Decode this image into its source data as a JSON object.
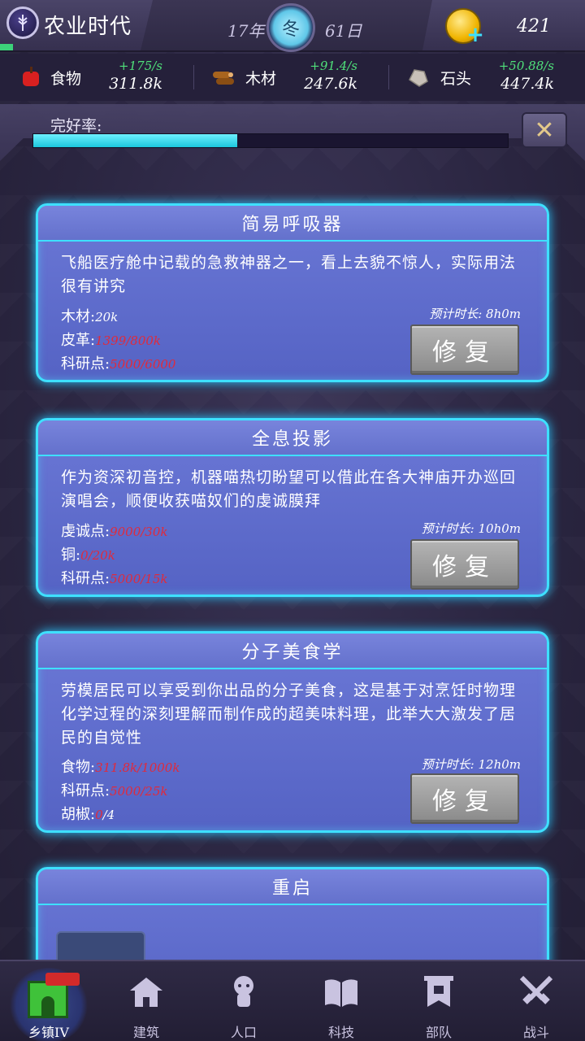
{
  "header": {
    "era_title": "农业时代",
    "year": "17年",
    "season": "冬",
    "day": "61日",
    "coins": "421"
  },
  "resources": [
    {
      "name": "食物",
      "rate": "+175/s",
      "amount": "311.8k",
      "icon": "apple-icon"
    },
    {
      "name": "木材",
      "rate": "+91.4/s",
      "amount": "247.6k",
      "icon": "log-icon"
    },
    {
      "name": "石头",
      "rate": "+50.88/s",
      "amount": "447.4k",
      "icon": "stone-icon"
    }
  ],
  "integrity": {
    "label": "完好率:",
    "progress_fraction": 0.43
  },
  "cards": [
    {
      "title": "简易呼吸器",
      "desc": "飞船医疗舱中记载的急救神器之一，看上去貌不惊人，实际用法很有讲究",
      "duration": "预计时长: 8h0m",
      "repair": "修复",
      "reqs": [
        {
          "label": "木材:",
          "value": "20k",
          "ok": true
        },
        {
          "label": "皮革:",
          "value": "1399/800k",
          "ok": false
        },
        {
          "label": "科研点:",
          "value": "5000/6000",
          "ok": false
        }
      ]
    },
    {
      "title": "全息投影",
      "desc": "作为资深初音控，机器喵热切盼望可以借此在各大神庙开办巡回演唱会，顺便收获喵奴们的虔诚膜拜",
      "duration": "预计时长: 10h0m",
      "repair": "修复",
      "reqs": [
        {
          "label": "虔诚点:",
          "value": "9000/30k",
          "ok": false
        },
        {
          "label": "铜:",
          "value": "0/20k",
          "ok": false
        },
        {
          "label": "科研点:",
          "value": "5000/15k",
          "ok": false
        }
      ]
    },
    {
      "title": "分子美食学",
      "desc": "劳模居民可以享受到你出品的分子美食，这是基于对烹饪时物理化学过程的深刻理解而制作成的超美味料理，此举大大激发了居民的自觉性",
      "duration": "预计时长: 12h0m",
      "repair": "修复",
      "reqs": [
        {
          "label": "食物:",
          "value": "311.8k/1000k",
          "ok": false
        },
        {
          "label": "科研点:",
          "value": "5000/25k",
          "ok": false
        },
        {
          "label": "胡椒:",
          "value_bad": "0",
          "value_rest": "/4",
          "ok": false
        }
      ]
    },
    {
      "title": "重启"
    }
  ],
  "nav": [
    {
      "label": "乡镇IV",
      "icon": "castle-icon",
      "active": true
    },
    {
      "label": "建筑",
      "icon": "house-icon"
    },
    {
      "label": "人口",
      "icon": "person-icon"
    },
    {
      "label": "科技",
      "icon": "book-icon"
    },
    {
      "label": "部队",
      "icon": "banner-icon"
    },
    {
      "label": "战斗",
      "icon": "swords-icon"
    }
  ],
  "colors": {
    "accent": "#3ee0ff",
    "progress": "#1cc6dc",
    "warning": "#e02a3c",
    "rate": "#4fe07a"
  }
}
